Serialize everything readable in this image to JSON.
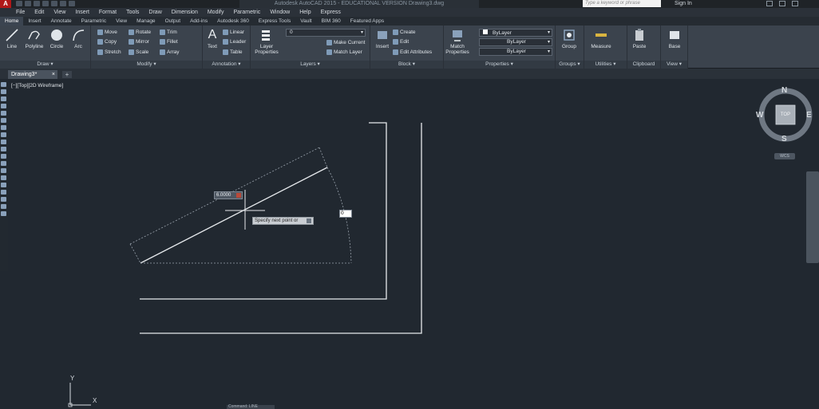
{
  "titlebar": {
    "app_title": "Autodesk AutoCAD 2015 - EDUCATIONAL VERSION   Drawing3.dwg",
    "search_placeholder": "Type a keyword or phrase",
    "sign_in": "Sign In"
  },
  "menu": [
    "File",
    "Edit",
    "View",
    "Insert",
    "Format",
    "Tools",
    "Draw",
    "Dimension",
    "Modify",
    "Parametric",
    "Window",
    "Help",
    "Express"
  ],
  "ribbon_tabs": [
    "Home",
    "Insert",
    "Annotate",
    "Parametric",
    "View",
    "Manage",
    "Output",
    "Add-ins",
    "Autodesk 360",
    "Express Tools",
    "Vault",
    "BIM 360",
    "Featured Apps"
  ],
  "ribbon": {
    "draw": {
      "label": "Draw ▾",
      "line": "Line",
      "polyline": "Polyline",
      "circle": "Circle",
      "arc": "Arc"
    },
    "modify": {
      "label": "Modify ▾",
      "move": "Move",
      "rotate": "Rotate",
      "trim": "Trim",
      "copy": "Copy",
      "mirror": "Mirror",
      "fillet": "Fillet",
      "stretch": "Stretch",
      "scale": "Scale",
      "array": "Array"
    },
    "annotation": {
      "label": "Annotation ▾",
      "text": "Text",
      "linear": "Linear",
      "leader": "Leader",
      "table": "Table"
    },
    "layers": {
      "label": "Layers ▾",
      "layer_properties": "Layer Properties",
      "current_layer": "0",
      "make_current": "Make Current",
      "match_layer": "Match Layer"
    },
    "block": {
      "label": "Block ▾",
      "insert": "Insert",
      "create": "Create",
      "edit": "Edit",
      "edit_attributes": "Edit Attributes"
    },
    "properties": {
      "label": "Properties ▾",
      "match_properties": "Match Properties",
      "color": "ByLayer",
      "linetype": "ByLayer",
      "lineweight": "ByLayer"
    },
    "groups": {
      "label": "Groups ▾",
      "group": "Group"
    },
    "utilities": {
      "label": "Utilities ▾",
      "measure": "Measure"
    },
    "clipboard": {
      "label": "Clipboard",
      "paste": "Paste"
    },
    "view": {
      "label": "View ▾",
      "base": "Base"
    }
  },
  "file_tab": {
    "name": "Drawing3*"
  },
  "viewport": {
    "label": "[−][Top][2D Wireframe]"
  },
  "viewcube": {
    "north": "N",
    "south": "S",
    "east": "E",
    "west": "W",
    "face": "TOP",
    "ucs": "WCS"
  },
  "dynamic_input": {
    "length": "6.0000",
    "prompt": "Specify next point or",
    "angle": "0"
  },
  "ucs_icon": {
    "x": "X",
    "y": "Y"
  },
  "command_line": {
    "text": "Command:   LINE"
  }
}
